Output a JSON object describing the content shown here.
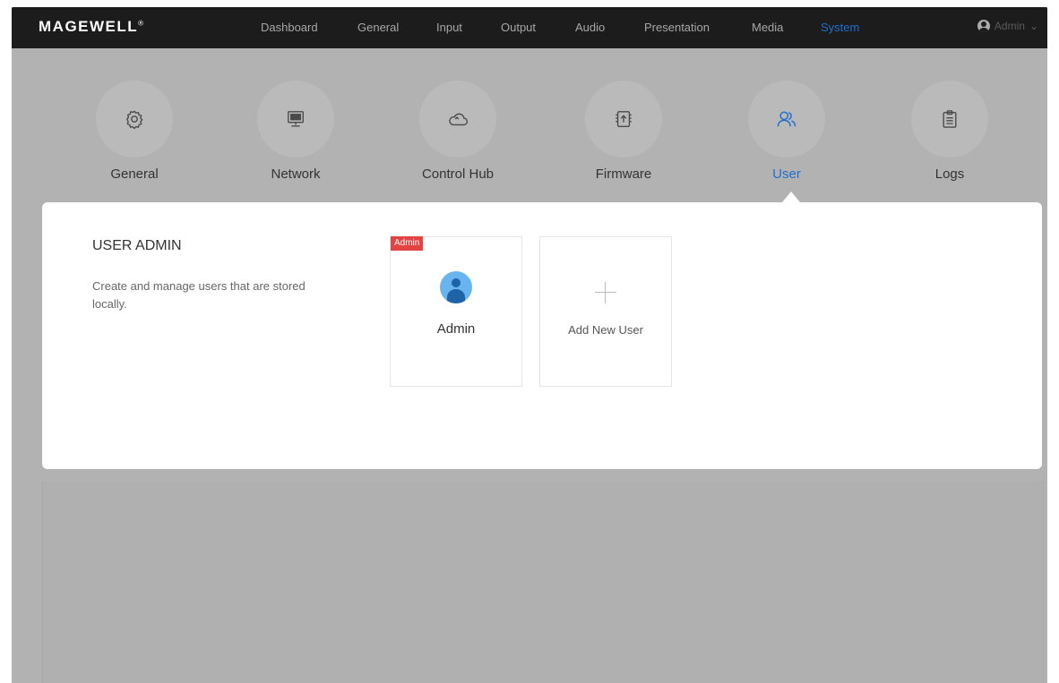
{
  "app": {
    "logo": "MAGEWELL",
    "logo_mark": "®"
  },
  "topnav": {
    "items": [
      {
        "label": "Dashboard"
      },
      {
        "label": "General"
      },
      {
        "label": "Input"
      },
      {
        "label": "Output"
      },
      {
        "label": "Audio"
      },
      {
        "label": "Presentation"
      },
      {
        "label": "Media"
      },
      {
        "label": "System",
        "active": true
      }
    ],
    "user_label": "Admin",
    "user_icon": "user-circle-icon",
    "chevron_icon": "chevron-down-icon",
    "chevron_glyph": "⌄"
  },
  "subnav": {
    "items": [
      {
        "label": "General",
        "icon": "gear-icon"
      },
      {
        "label": "Network",
        "icon": "monitor-icon"
      },
      {
        "label": "Control Hub",
        "icon": "cloud-icon"
      },
      {
        "label": "Firmware",
        "icon": "firmware-upload-icon"
      },
      {
        "label": "User",
        "icon": "users-icon",
        "active": true
      },
      {
        "label": "Logs",
        "icon": "clipboard-icon"
      }
    ]
  },
  "user_admin": {
    "title": "USER ADMIN",
    "description": "Create and manage users that are stored locally.",
    "users": [
      {
        "name": "Admin",
        "badge": "Admin"
      }
    ],
    "add_label": "Add New User"
  },
  "colors": {
    "topbar": "#1c1c1c",
    "accent": "#1f6fce",
    "badge": "#e24444",
    "overlay": "#b2b2b2",
    "panel": "#ffffff"
  }
}
